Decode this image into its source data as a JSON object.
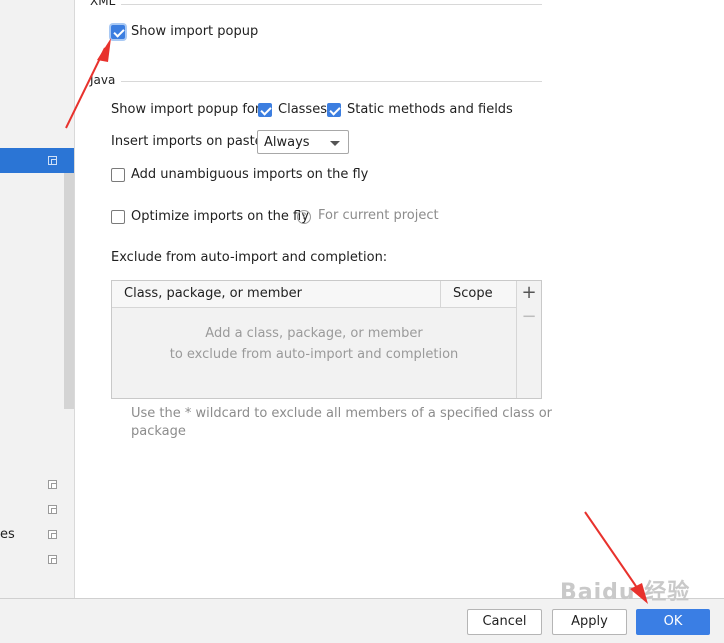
{
  "sidebar": {
    "partial_label": "es",
    "selected_item_icon": "copy-icon",
    "item_icons": [
      "copy-icon",
      "copy-icon",
      "copy-icon",
      "copy-icon"
    ]
  },
  "xml_section": {
    "title": "XML",
    "show_import_popup": {
      "label": "Show import popup",
      "checked": true
    }
  },
  "java_section": {
    "title": "Java",
    "show_popup_for_label": "Show import popup for:",
    "classes": {
      "label": "Classes",
      "checked": true
    },
    "static_methods": {
      "label": "Static methods and fields",
      "checked": true
    },
    "insert_on_paste_label": "Insert imports on paste:",
    "insert_on_paste_value": "Always",
    "add_unambiguous": {
      "label": "Add unambiguous imports on the fly",
      "checked": false
    },
    "optimize_imports": {
      "label": "Optimize imports on the fly",
      "checked": false,
      "note": "For current project"
    }
  },
  "exclude": {
    "title": "Exclude from auto-import and completion:",
    "columns": [
      "Class, package, or member",
      "Scope"
    ],
    "empty_line1": "Add a class, package, or member",
    "empty_line2": "to exclude from auto-import and completion",
    "add_symbol": "+",
    "remove_symbol": "−",
    "hint_line1": "Use the * wildcard to exclude all members of a specified class or",
    "hint_line2": "package"
  },
  "footer": {
    "cancel_label": "Cancel",
    "apply_label": "Apply",
    "ok_label": "OK"
  },
  "watermark": "Baidu 经验",
  "colors": {
    "accent": "#3a7ee4",
    "selection": "#2b75d5",
    "annotation_arrow": "#e8322d"
  }
}
